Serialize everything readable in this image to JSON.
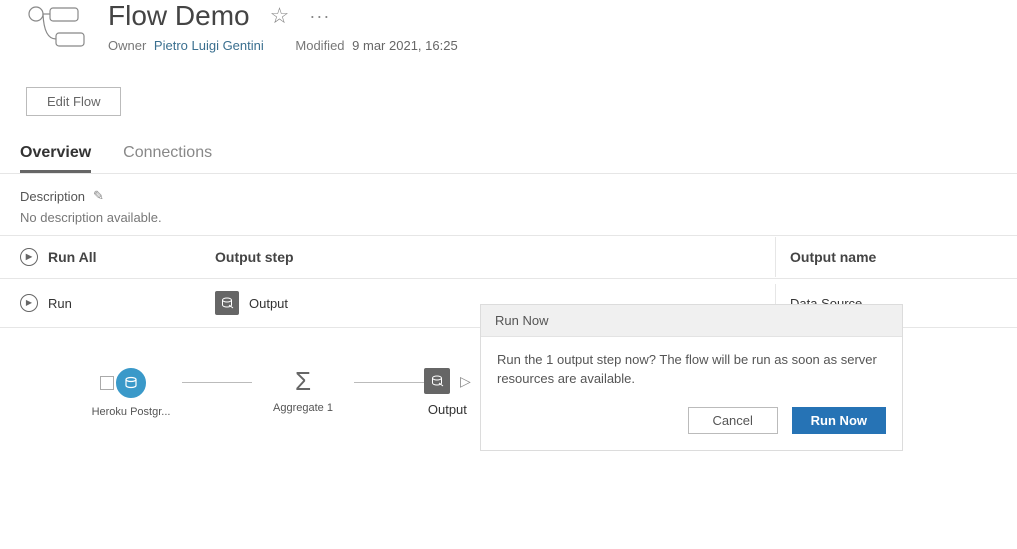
{
  "header": {
    "title": "Flow Demo",
    "owner_label": "Owner",
    "owner_name": "Pietro Luigi Gentini",
    "modified_label": "Modified",
    "modified_value": "9 mar 2021, 16:25",
    "edit_button": "Edit Flow"
  },
  "tabs": {
    "overview": "Overview",
    "connections": "Connections"
  },
  "description": {
    "label": "Description",
    "text": "No description available."
  },
  "grid": {
    "run_all": "Run All",
    "output_step": "Output step",
    "output_name": "Output name",
    "rows": [
      {
        "run": "Run",
        "step": "Output",
        "name": "Data Source"
      }
    ]
  },
  "pipeline": {
    "nodes": [
      {
        "label": "Heroku Postgr..."
      },
      {
        "label": "Aggregate 1"
      },
      {
        "label": "Output"
      }
    ]
  },
  "modal": {
    "title": "Run Now",
    "body": "Run the 1 output step now? The flow will be run as soon as server resources are available.",
    "cancel": "Cancel",
    "confirm": "Run Now"
  },
  "icons": {
    "star": "☆",
    "more": "···",
    "pencil": "✎",
    "play_triangle": "▶",
    "play_outline": "▷"
  }
}
